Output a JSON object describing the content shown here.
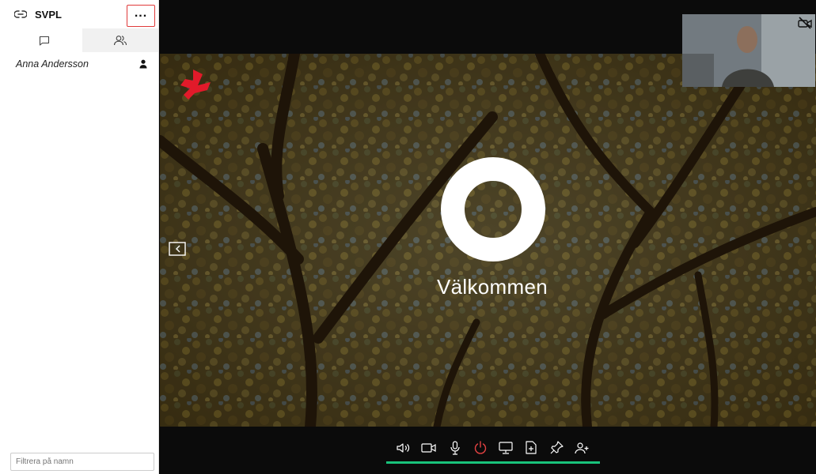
{
  "sidebar": {
    "conference_name": "SVPL",
    "tabs": [
      {
        "name": "chat",
        "icon": "chat-icon"
      },
      {
        "name": "participants",
        "icon": "participants-icon",
        "active": true
      }
    ],
    "participants": [
      {
        "name": "Anna Andersson",
        "icon": "person-icon"
      }
    ],
    "filter_placeholder": "Filtrera på namn"
  },
  "stage": {
    "welcome_text": "Välkommen",
    "brand_icon": "brand-logo-icon",
    "self_view_icon": "camera-off-icon"
  },
  "toolbar": {
    "buttons": [
      {
        "name": "speaker",
        "icon": "speaker-icon"
      },
      {
        "name": "camera",
        "icon": "camera-icon"
      },
      {
        "name": "microphone",
        "icon": "microphone-icon"
      },
      {
        "name": "hang-up",
        "icon": "power-icon"
      },
      {
        "name": "share-screen",
        "icon": "monitor-icon"
      },
      {
        "name": "share-file",
        "icon": "file-add-icon"
      },
      {
        "name": "pin",
        "icon": "pin-icon"
      },
      {
        "name": "add-participant",
        "icon": "add-person-icon"
      }
    ],
    "accent_color": "#19c27b",
    "hangup_color": "#e34242"
  }
}
